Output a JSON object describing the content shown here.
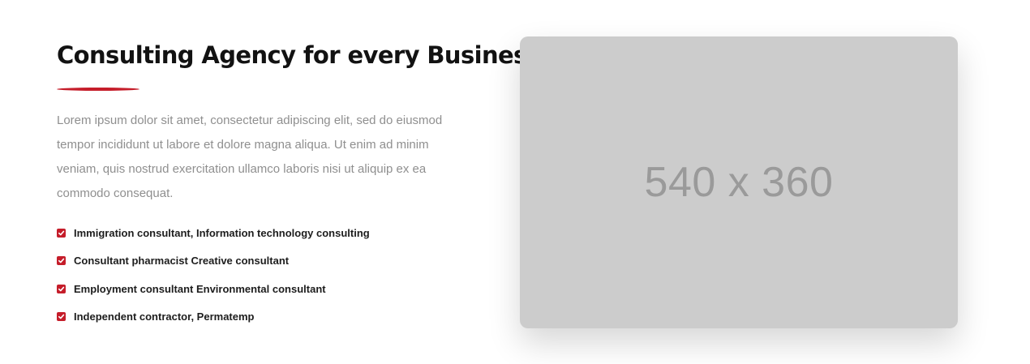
{
  "section": {
    "title": "Consulting Agency for every Business",
    "paragraph": "Lorem ipsum dolor sit amet, consectetur adipiscing elit, sed do eiusmod tempor incididunt ut labore et dolore magna aliqua. Ut enim ad minim veniam, quis nostrud exercitation ullamco laboris nisi ut aliquip ex ea commodo consequat.",
    "checklist": [
      {
        "label": "Immigration consultant, Information technology consulting",
        "icon": "check-square-icon"
      },
      {
        "label": "Consultant pharmacist Creative consultant",
        "icon": "check-square-icon"
      },
      {
        "label": "Employment consultant Environmental consultant",
        "icon": "check-square-icon"
      },
      {
        "label": "Independent contractor, Permatemp",
        "icon": "check-square-icon"
      }
    ]
  },
  "image": {
    "placeholder_text": "540 x 360"
  },
  "colors": {
    "accent": "#c51d2a",
    "heading": "#121212",
    "body_text": "#8f8f8f",
    "placeholder_bg": "#cccccc",
    "placeholder_text": "#9a9a9a"
  }
}
